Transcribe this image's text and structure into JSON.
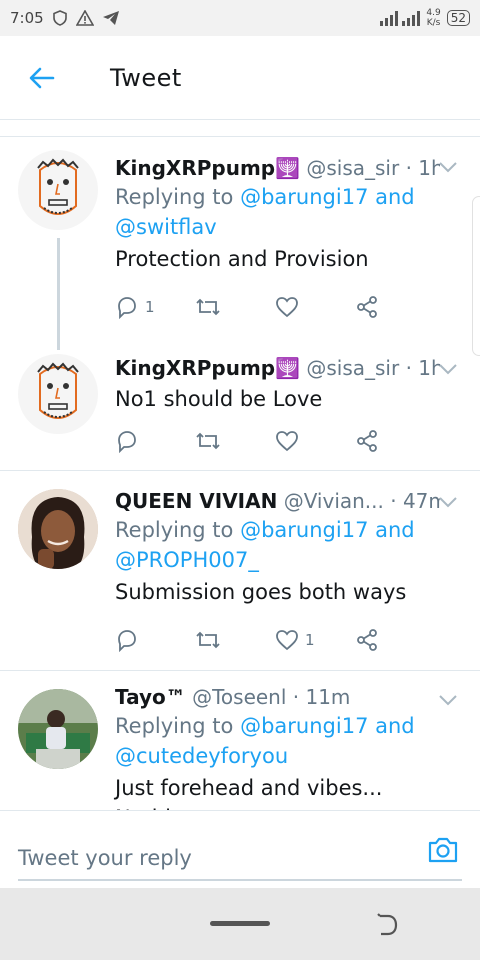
{
  "status": {
    "time": "7:05",
    "net_top": "4.9",
    "net_bottom": "K/s",
    "battery": "52"
  },
  "header": {
    "title": "Tweet"
  },
  "tweets": [
    {
      "name": "KingXRPpump🕎",
      "handle": "@sisa_sir · 1h",
      "reply_prefix": "Replying to",
      "reply_links": "@barungi17 and",
      "reply_links2": "@switflav",
      "text": "Protection and Provision",
      "reply_count": "1",
      "like_count": ""
    },
    {
      "name": "KingXRPpump🕎",
      "handle": "@sisa_sir · 1h",
      "text": "No1 should be Love",
      "reply_count": "",
      "like_count": ""
    },
    {
      "name": "QUEEN VIVIAN",
      "handle": "@Vivian...  · 47m",
      "reply_prefix": "Replying to",
      "reply_links": "@barungi17 and",
      "reply_links2": "@PROPH007_",
      "text": "Submission goes both ways",
      "reply_count": "",
      "like_count": "1"
    },
    {
      "name": "Tayo™",
      "handle": "@Toseenl · 11m",
      "reply_prefix": "Replying to",
      "reply_links": "@barungi17 and",
      "reply_links2": "@cutedeyforyou",
      "text": "Just forehead and vibes... Nothing"
    }
  ],
  "reply_bar": {
    "placeholder": "Tweet your reply"
  },
  "colors": {
    "accent": "#1da1f2",
    "muted": "#657786",
    "divider": "#e1e8ed"
  }
}
